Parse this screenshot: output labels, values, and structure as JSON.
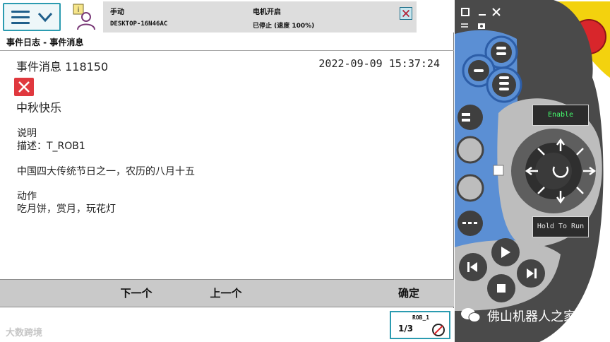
{
  "topbar": {
    "mode": "手动",
    "host": "DESKTOP-16N46AC",
    "motor": "电机开启",
    "state": "已停止 (速度 100%)"
  },
  "subtitle": "事件日志 - 事件消息",
  "message": {
    "title": "事件消息 118150",
    "timestamp": "2022-09-09 15:37:24",
    "heading": "中秋快乐",
    "description_header": "说明",
    "description": "描述：T_ROB1",
    "description_detail": "中国四大传统节日之一，农历的八月十五",
    "action_header": "动作",
    "action": "吃月饼，赏月，玩花灯"
  },
  "buttons": {
    "next": "下一个",
    "previous": "上一个",
    "ok": "确定"
  },
  "taskbar": {
    "robot": "ROB_1",
    "fraction_num": "1",
    "fraction_den": "3",
    "watermark": "大数跨境"
  },
  "device": {
    "enable_label": "Enable",
    "hold_label": "Hold To Run",
    "watermark": "佛山机器人之家"
  },
  "colors": {
    "accent": "#2b9bb0",
    "error": "#e0383e",
    "device_body": "#4a4a4a",
    "device_blue": "#5b8fd4",
    "emergency_red": "#d8262b",
    "enable_green": "#45ff6e"
  }
}
